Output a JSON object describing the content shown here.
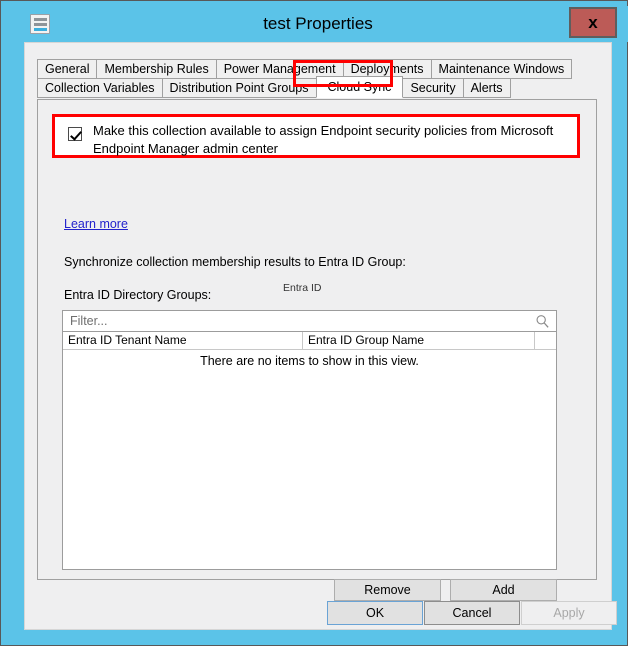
{
  "window": {
    "title": "test Properties",
    "icon": "collection-icon",
    "close_label": "x",
    "titlebar_color": "#5bc3e8",
    "close_button_color": "#bc5b57",
    "highlight_color": "#ff0000"
  },
  "tabs": {
    "row1": [
      {
        "label": "General",
        "selected": false
      },
      {
        "label": "Membership Rules",
        "selected": false
      },
      {
        "label": "Power Management",
        "selected": false
      },
      {
        "label": "Deployments",
        "selected": false
      },
      {
        "label": "Maintenance Windows",
        "selected": false
      }
    ],
    "row2": [
      {
        "label": "Collection Variables",
        "selected": false
      },
      {
        "label": "Distribution Point Groups",
        "selected": false
      },
      {
        "label": "Cloud Sync",
        "selected": true
      },
      {
        "label": "Security",
        "selected": false
      },
      {
        "label": "Alerts",
        "selected": false
      }
    ]
  },
  "panel": {
    "checkbox": {
      "checked": true,
      "label": "Make this collection available to assign Endpoint security policies from Microsoft Endpoint Manager admin center"
    },
    "learn_more": "Learn more",
    "sync_label": "Synchronize collection membership results to  Entra ID Group:",
    "directory_groups_label": "Entra ID Directory Groups:",
    "entra_id_caption": "Entra ID",
    "filter": {
      "placeholder": "Filter...",
      "value": "",
      "icon": "search-icon"
    },
    "list": {
      "columns": [
        "Entra ID  Tenant  Name",
        "Entra ID  Group  Name",
        ""
      ],
      "rows": [],
      "empty_message": "There are no items to show in this view."
    },
    "remove_button": "Remove",
    "add_button": "Add"
  },
  "footer": {
    "ok": "OK",
    "cancel": "Cancel",
    "apply": "Apply",
    "apply_enabled": false
  }
}
